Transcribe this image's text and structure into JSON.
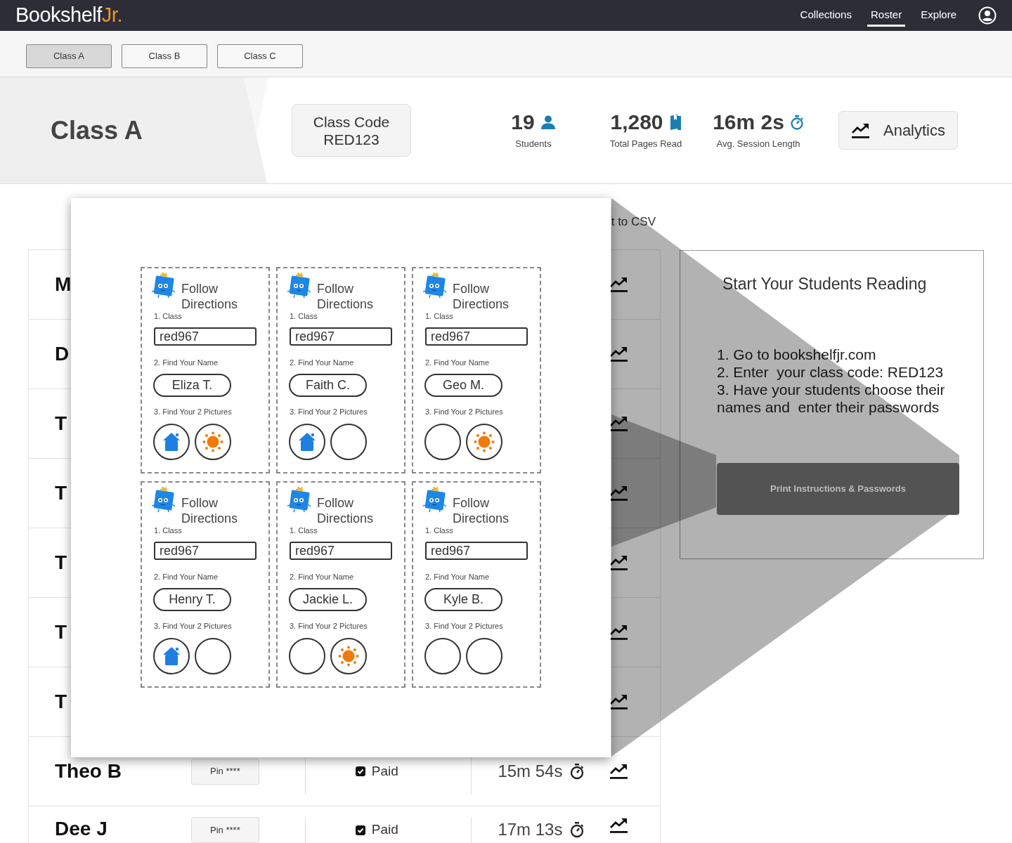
{
  "app": {
    "logo": {
      "name": "Bookshelf",
      "accent": "Jr."
    },
    "nav": [
      {
        "label": "Collections",
        "selected": false
      },
      {
        "label": "Roster",
        "selected": true
      },
      {
        "label": "Explore",
        "selected": false
      }
    ]
  },
  "class_tabs": [
    {
      "label": "Class A",
      "selected": true
    },
    {
      "label": "Class B",
      "selected": false
    },
    {
      "label": "Class C",
      "selected": false
    }
  ],
  "header": {
    "title": "Class A",
    "class_code": {
      "label": "Class Code",
      "code": "RED123"
    },
    "stats": [
      {
        "kind": "students",
        "value": "19",
        "label": "Students"
      },
      {
        "kind": "pages",
        "value": "1,280",
        "label": "Total Pages Read"
      },
      {
        "kind": "time",
        "value": "16m 2s",
        "label": "Avg. Session Length"
      }
    ],
    "analytics_button": "Analytics"
  },
  "export_link": "t to CSV",
  "roster": [
    {
      "name": "M"
    },
    {
      "name": "D"
    },
    {
      "name": "T"
    },
    {
      "name": "T"
    },
    {
      "name": "T"
    },
    {
      "name": "T"
    },
    {
      "name": "T"
    },
    {
      "name": "Theo B",
      "pin": "Pin ****",
      "paid": true,
      "paid_label": "Paid",
      "time": "15m 54s"
    },
    {
      "name": "Dee J",
      "pin": "Pin ****",
      "paid": true,
      "paid_label": "Paid",
      "time": "17m 13s"
    }
  ],
  "print_preview": {
    "cards": [
      {
        "title": "Follow Directions",
        "step1": "1. Class",
        "class_value": "red967",
        "step2": "2. Find Your Name",
        "student": "Eliza T.",
        "step3": "3. Find Your 2 Pictures",
        "pictures": [
          {
            "kind": "house"
          },
          {
            "kind": "sun"
          }
        ]
      },
      {
        "title": "Follow Directions",
        "step1": "1. Class",
        "class_value": "red967",
        "step2": "2. Find Your Name",
        "student": "Faith C.",
        "step3": "3. Find Your 2 Pictures",
        "pictures": [
          {
            "kind": "house"
          },
          {
            "kind": "empty"
          }
        ]
      },
      {
        "title": "Follow Directions",
        "step1": "1. Class",
        "class_value": "red967",
        "step2": "2. Find Your Name",
        "student": "Geo M.",
        "step3": "3. Find Your 2 Pictures",
        "pictures": [
          {
            "kind": "empty"
          },
          {
            "kind": "sun"
          }
        ]
      },
      {
        "title": "Follow Directions",
        "step1": "1. Class",
        "class_value": "red967",
        "step2": "2. Find Your Name",
        "student": "Henry T.",
        "step3": "3. Find Your 2 Pictures",
        "pictures": [
          {
            "kind": "house"
          },
          {
            "kind": "empty"
          }
        ]
      },
      {
        "title": "Follow Directions",
        "step1": "1. Class",
        "class_value": "red967",
        "step2": "2. Find Your Name",
        "student": "Jackie L.",
        "step3": "3. Find Your 2 Pictures",
        "pictures": [
          {
            "kind": "empty"
          },
          {
            "kind": "sun"
          }
        ]
      },
      {
        "title": "Follow Directions",
        "step1": "1. Class",
        "class_value": "red967",
        "step2": "2. Find Your Name",
        "student": "Kyle B.",
        "step3": "3. Find Your 2 Pictures",
        "pictures": [
          {
            "kind": "empty"
          },
          {
            "kind": "empty"
          }
        ]
      }
    ]
  },
  "instructions_panel": {
    "title": "Start Your Students Reading",
    "steps": [
      "1. Go to bookshelfjr.com",
      "2. Enter  your class code: RED123",
      "3. Have your students choose their names and  enter their passwords"
    ],
    "button": "Print Instructions & Passwords"
  }
}
